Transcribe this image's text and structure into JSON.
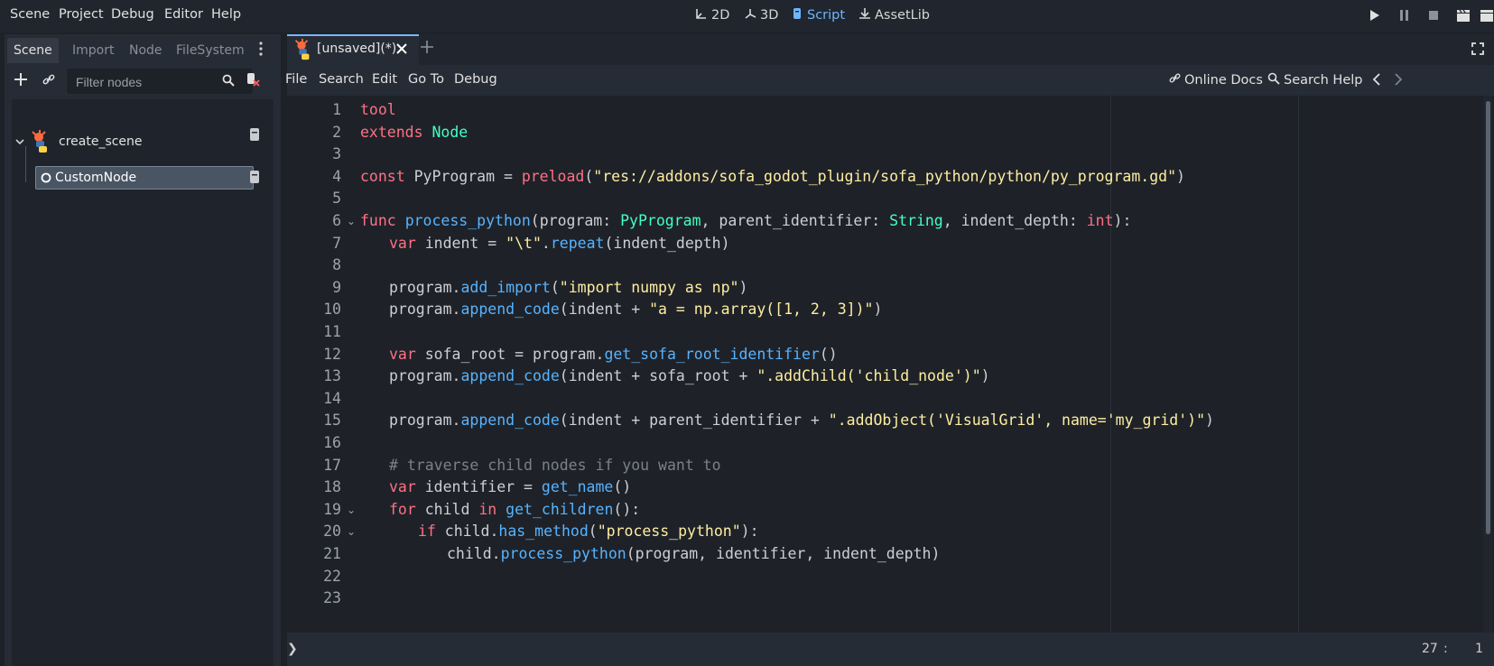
{
  "menu": {
    "items": [
      "Scene",
      "Project",
      "Debug",
      "Editor",
      "Help"
    ]
  },
  "workspaces": [
    {
      "label": "2D",
      "icon": "2d-icon"
    },
    {
      "label": "3D",
      "icon": "3d-icon"
    },
    {
      "label": "Script",
      "icon": "script-icon",
      "active": true
    },
    {
      "label": "AssetLib",
      "icon": "assetlib-icon"
    }
  ],
  "playback": [
    "play-icon",
    "pause-icon",
    "stop-icon",
    "clapperboard-icon"
  ],
  "dock": {
    "tabs": [
      "Scene",
      "Import",
      "Node",
      "FileSystem"
    ],
    "filter_placeholder": "Filter nodes",
    "tree": [
      {
        "label": "create_scene",
        "icon": "python-godot-icon",
        "depth": 0
      },
      {
        "label": "CustomNode",
        "icon": "node-circle-icon",
        "depth": 1,
        "selected": true
      }
    ]
  },
  "editor": {
    "tab_label": "[unsaved](*)",
    "script_menu": [
      "File",
      "Search",
      "Edit",
      "Go To",
      "Debug"
    ],
    "online_docs": "Online Docs",
    "search_help": "Search Help",
    "code_lines": [
      "tool",
      "extends Node",
      "",
      "const PyProgram = preload(\"res://addons/sofa_godot_plugin/sofa_python/python/py_program.gd\")",
      "",
      "func process_python(program: PyProgram, parent_identifier: String, indent_depth: int):",
      "\tvar indent = \"\\t\".repeat(indent_depth)",
      "",
      "\tprogram.add_import(\"import numpy as np\")",
      "\tprogram.append_code(indent + \"a = np.array([1, 2, 3])\")",
      "",
      "\tvar sofa_root = program.get_sofa_root_identifier()",
      "\tprogram.append_code(indent + sofa_root + \".addChild('child_node')\")",
      "",
      "\tprogram.append_code(indent + parent_identifier + \".addObject('VisualGrid', name='my_grid')\")",
      "",
      "\t# traverse child nodes if you want to",
      "\tvar identifier = get_name()",
      "\tfor child in get_children():",
      "\t\tif child.has_method(\"process_python\"):",
      "\t\t\tchild.process_python(program, identifier, indent_depth)",
      "",
      ""
    ],
    "fold_lines": [
      6,
      19,
      20
    ],
    "status": {
      "line": "27",
      "separator": ":",
      "column": "1",
      "toggle": "❯"
    }
  }
}
